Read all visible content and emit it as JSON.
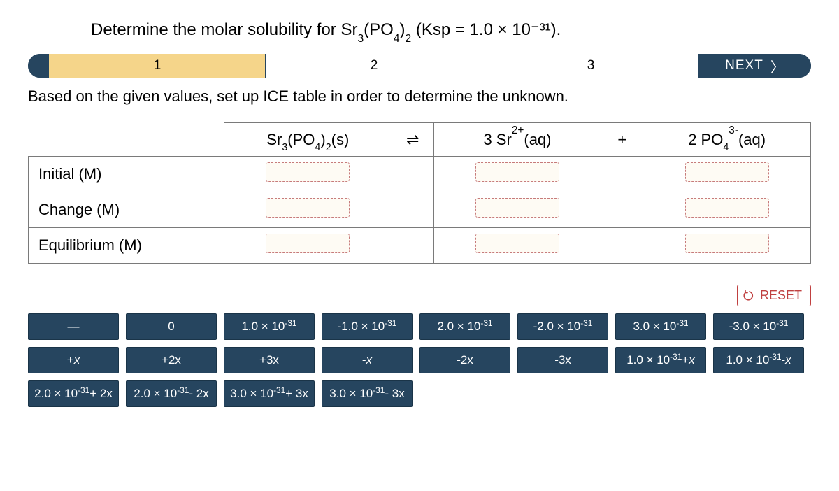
{
  "question_prefix": "Determine the molar solubility for ",
  "question_suffix": " (Ksp = 1.0 × 10⁻³¹).",
  "compound_html": "Sr<sub>3</sub>(PO<sub>4</sub>)<sub>2</sub>",
  "progress": {
    "steps": [
      "1",
      "2",
      "3"
    ],
    "next": "NEXT"
  },
  "instruction": "Based on the given values, set up ICE table in order to determine the unknown.",
  "table": {
    "headers": {
      "col1_html": "Sr<sub>3</sub>(PO<sub>4</sub>)<sub>2</sub>(s)",
      "eq": "⇌",
      "col2_html": "3 Sr<sup>2+</sup>(aq)",
      "plus": "+",
      "col3_html": "2 PO<sub>4</sub><sup>3-</sup>(aq)"
    },
    "rows": [
      "Initial (M)",
      "Change (M)",
      "Equilibrium (M)"
    ]
  },
  "reset": "RESET",
  "tiles": [
    [
      "—",
      "0",
      "1.0 × 10⁻³¹",
      "-1.0 × 10⁻³¹",
      "2.0 × 10⁻³¹",
      "-2.0 × 10⁻³¹",
      "3.0 × 10⁻³¹",
      "-3.0 × 10⁻³¹"
    ],
    [
      "+x",
      "+2x",
      "+3x",
      "-x",
      "-2x",
      "-3x",
      "1.0 × 10⁻³¹ + x",
      "1.0 × 10⁻³¹ - x"
    ],
    [
      "2.0 × 10⁻³¹ + 2x",
      "2.0 × 10⁻³¹ - 2x",
      "3.0 × 10⁻³¹ + 3x",
      "3.0 × 10⁻³¹ - 3x"
    ]
  ]
}
